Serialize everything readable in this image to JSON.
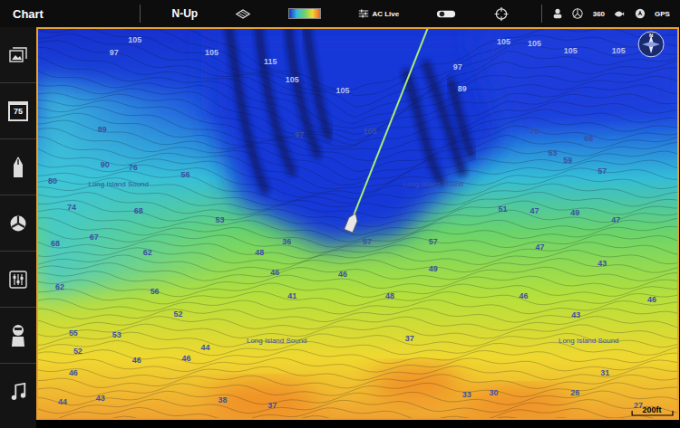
{
  "topbar": {
    "title": "Chart",
    "orientation": "N-Up",
    "ac_live": "AC Live",
    "status": [
      "360",
      "GPS"
    ]
  },
  "sidebar": {
    "calendar_day": "75"
  },
  "map": {
    "depth_labels": [
      "105",
      "97",
      "105",
      "115",
      "105",
      "105",
      "105",
      "97",
      "97",
      "105",
      "105",
      "105",
      "105",
      "89",
      "89",
      "90",
      "76",
      "80",
      "74",
      "68",
      "68",
      "67",
      "62",
      "62",
      "56",
      "52",
      "55",
      "53",
      "52",
      "46",
      "46",
      "46",
      "44",
      "43",
      "44",
      "38",
      "37",
      "53",
      "56",
      "48",
      "46",
      "46",
      "48",
      "49",
      "57",
      "57",
      "51",
      "73",
      "68",
      "53",
      "59",
      "57",
      "47",
      "49",
      "47",
      "47",
      "43",
      "46",
      "43",
      "46",
      "37",
      "33",
      "30",
      "26",
      "31",
      "27",
      "41",
      "36"
    ],
    "area_labels": [
      "Long Island Sound",
      "Long Island Sound",
      "Long Island Sound",
      "Long Island Sound"
    ],
    "scale": "200ft",
    "compass": "N"
  }
}
